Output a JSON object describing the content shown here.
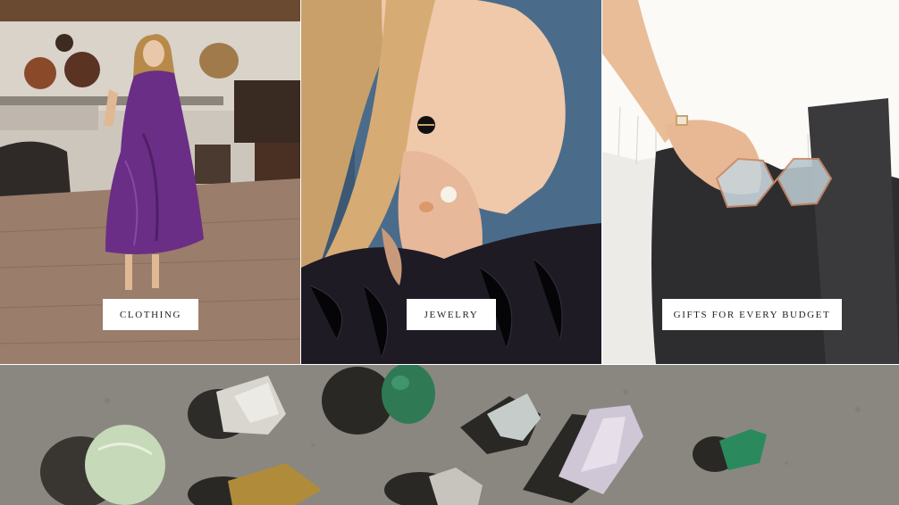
{
  "categories": [
    {
      "label": "CLOTHING",
      "image_desc": "clothing-photo"
    },
    {
      "label": "JEWELRY",
      "image_desc": "jewelry-photo"
    },
    {
      "label": "GIFTS FOR EVERY BUDGET",
      "image_desc": "gifts-photo"
    }
  ],
  "colors": {
    "button_bg": "#ffffff",
    "button_text": "#222222",
    "concrete": "#8a8780"
  }
}
